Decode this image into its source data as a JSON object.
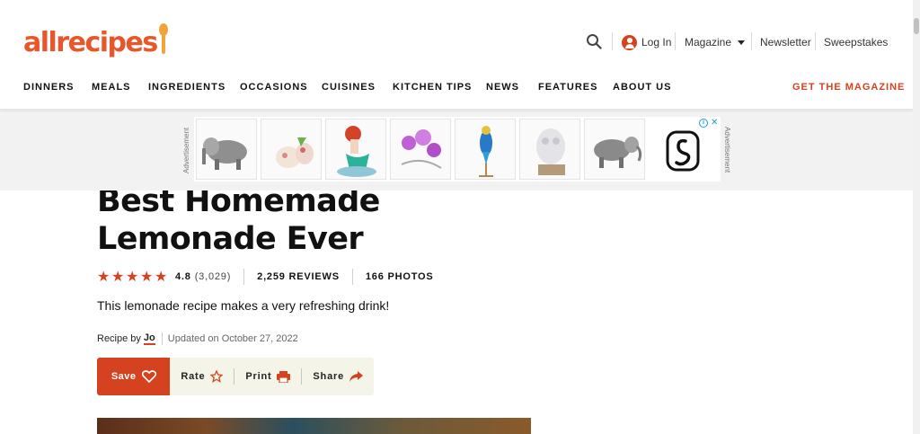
{
  "brand": {
    "logo_text": "allrecipes",
    "accent": "#d5421f",
    "logo_color": "#e8562a"
  },
  "utility": {
    "search_icon": "search-icon",
    "login_label": "Log In",
    "magazine_label": "Magazine",
    "newsletter_label": "Newsletter",
    "sweepstakes_label": "Sweepstakes"
  },
  "nav": {
    "items": [
      "DINNERS",
      "MEALS",
      "INGREDIENTS",
      "OCCASIONS",
      "CUISINES",
      "KITCHEN TIPS",
      "NEWS",
      "FEATURES",
      "ABOUT US"
    ],
    "cta": "GET THE MAGAZINE"
  },
  "ad": {
    "label": "Advertisement",
    "tiles": [
      "elephant-figurine",
      "cow-figurine",
      "mermaid-figurine",
      "orchid-figurine",
      "parrot-figurine",
      "owl-figurine",
      "elephant-figurine"
    ],
    "brand_icon": "swan-logo-icon"
  },
  "recipe": {
    "title": "Best Homemade Lemonade Ever",
    "rating_value": "4.8",
    "rating_count": "(3,029)",
    "stars": 5,
    "reviews": "2,259 REVIEWS",
    "photos": "166 PHOTOS",
    "description": "This lemonade recipe makes a very refreshing drink!",
    "byline_prefix": "Recipe by",
    "author": "Jo",
    "updated": "Updated on October 27, 2022"
  },
  "actions": {
    "save": "Save",
    "rate": "Rate",
    "print": "Print",
    "share": "Share"
  }
}
